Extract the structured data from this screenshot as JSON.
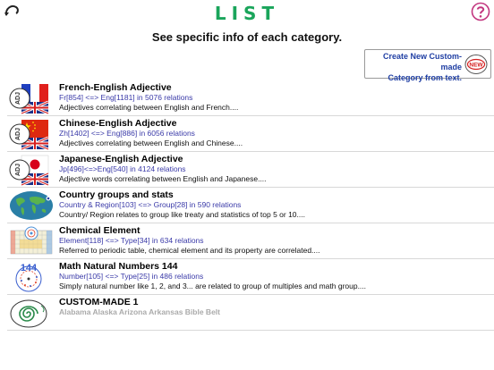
{
  "header": {
    "title": "LIST",
    "subtitle": "See specific info of each category."
  },
  "create_button": {
    "label_line1": "Create New Custom-made",
    "label_line2": "Category from text.",
    "badge": "NEW"
  },
  "thumb_labels": {
    "adj": "ADJ",
    "number": "144"
  },
  "categories": [
    {
      "title": "French-English Adjective",
      "meta": "Fr[854] <=> Eng[1181] in 5076 relations",
      "desc": "Adjectives correlating between English and French...."
    },
    {
      "title": "Chinese-English Adjective",
      "meta": "Zh[1402] <=> Eng[886] in 6056 relations",
      "desc": "Adjectives correlating between English and Chinese...."
    },
    {
      "title": "Japanese-English Adjective",
      "meta": "Jp[496]<=>Eng[540] in 4124 relations",
      "desc": "Adjective words correlating between English and Japanese...."
    },
    {
      "title": "Country groups and stats",
      "meta": "Country & Region[103] <=> Group[28] in 590 relations",
      "desc": "Country/ Region relates to group like treaty and statistics of top 5 or 10...."
    },
    {
      "title": "Chemical Element",
      "meta": "Element[118] <=> Type[34] in 634 relations",
      "desc": "Referred to periodic table, chemical element and its property are correlated...."
    },
    {
      "title": "Math Natural Numbers 144",
      "meta": "Number[105] <=> Type[25] in 486 relations",
      "desc": "Simply natural number like 1, 2, and 3... are related to group of multiples and math group...."
    },
    {
      "title": "CUSTOM-MADE 1",
      "desc": "Alabama Alaska Arizona Arkansas Bible Belt"
    }
  ]
}
